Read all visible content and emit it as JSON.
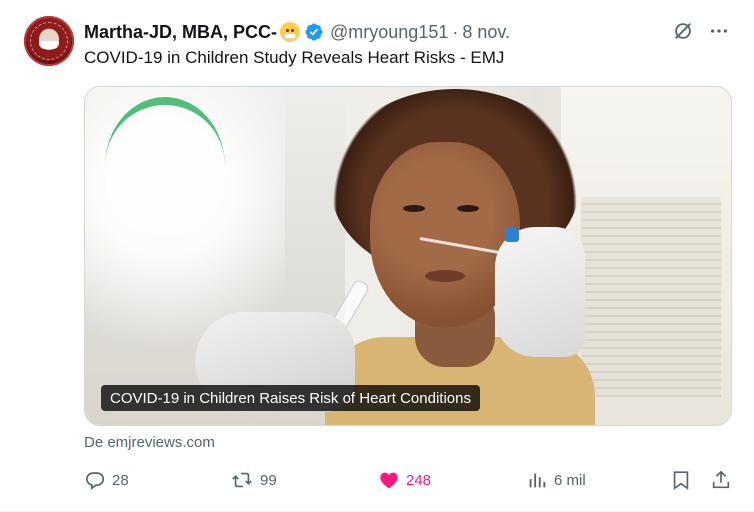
{
  "author": {
    "display_name": "Martha-JD, MBA, PCC-",
    "emoji": "face-with-medical-mask",
    "handle": "@mryoung151",
    "separator": "·",
    "date": "8 nov."
  },
  "tweet": {
    "text": "COVID-19 in Children Study Reveals Heart Risks - EMJ"
  },
  "card": {
    "title": "COVID-19 in Children Raises Risk of Heart Conditions",
    "source": "De emjreviews.com"
  },
  "actions": {
    "reply_count": "28",
    "retweet_count": "99",
    "like_count": "248",
    "views_count": "6 mil"
  },
  "colors": {
    "verified": "#1d9bf0",
    "like": "#f91880",
    "secondary_text": "#536471",
    "label_bg": "#000000"
  },
  "icons": {
    "top": [
      "grok-icon",
      "more-icon"
    ],
    "actions": [
      "reply-icon",
      "retweet-icon",
      "heart-icon",
      "views-icon",
      "bookmark-icon",
      "share-icon"
    ]
  }
}
